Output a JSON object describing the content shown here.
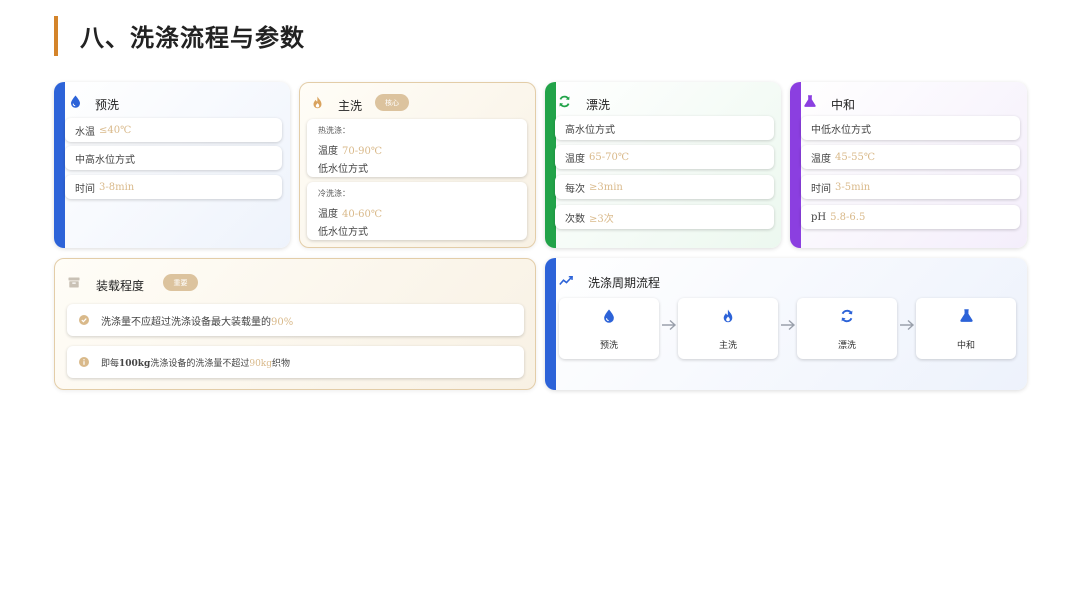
{
  "page": {
    "title": "八、洗涤流程与参数"
  },
  "colors": {
    "accent": "#d4842a",
    "blue": "#2d63d8",
    "green": "#22a349",
    "purple": "#8b3fe0",
    "gold": "#d9b98a"
  },
  "prewash": {
    "name": "预洗",
    "icon": "water-drop-icon",
    "rows": [
      {
        "label": "水温",
        "value": "≤40℃"
      },
      {
        "label": "中高水位方式",
        "value": ""
      },
      {
        "label": "时间",
        "value": "3-8min"
      }
    ]
  },
  "mainwash": {
    "name": "主洗",
    "icon": "fire-icon",
    "badge": "核心",
    "hot": {
      "label": "热洗涤：",
      "temp_label": "温度",
      "temp_value": "70-90℃",
      "level": "低水位方式"
    },
    "cold": {
      "label": "冷洗涤：",
      "temp_label": "温度",
      "temp_value": "40-60℃",
      "level": "低水位方式"
    }
  },
  "rinse": {
    "name": "漂洗",
    "icon": "recycle-icon",
    "rows": [
      {
        "label": "高水位方式",
        "value": ""
      },
      {
        "label": "温度",
        "value": "65-70℃"
      },
      {
        "label": "每次",
        "value": "≥3min"
      },
      {
        "label": "次数",
        "value": "≥3次"
      }
    ]
  },
  "neutralize": {
    "name": "中和",
    "icon": "flask-icon",
    "rows": [
      {
        "label": "中低水位方式",
        "value": ""
      },
      {
        "label": "温度",
        "value": "45-55℃"
      },
      {
        "label": "时间",
        "value": "3-5min"
      },
      {
        "label": "pH",
        "value": "5.8-6.5"
      }
    ]
  },
  "load": {
    "name": "装载程度",
    "icon": "box-icon",
    "badge": "重要",
    "rule1_text": "洗涤量不应超过洗涤设备最大装载量的",
    "rule1_value": "90%",
    "rule2_prefix": "即每",
    "rule2_bold": "100kg",
    "rule2_mid": "洗涤设备的洗涤量不超过",
    "rule2_value": "90kg",
    "rule2_suffix": "织物"
  },
  "cycle": {
    "name": "洗涤周期流程",
    "icon": "trend-line-icon",
    "steps": [
      {
        "label": "预洗",
        "icon": "water-drop-icon"
      },
      {
        "label": "主洗",
        "icon": "fire-icon"
      },
      {
        "label": "漂洗",
        "icon": "recycle-icon"
      },
      {
        "label": "中和",
        "icon": "flask-icon"
      }
    ]
  }
}
